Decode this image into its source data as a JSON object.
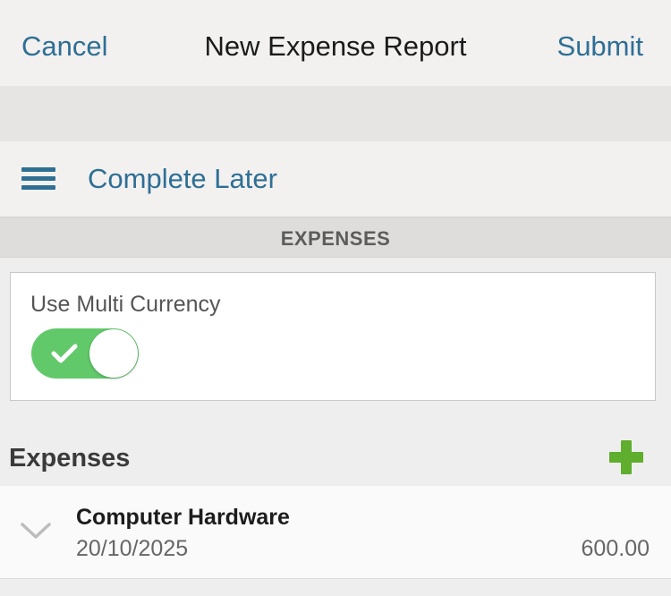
{
  "header": {
    "cancel_label": "Cancel",
    "title": "New Expense Report",
    "submit_label": "Submit"
  },
  "toolbar": {
    "menu_icon": "hamburger-menu-icon",
    "complete_later_label": "Complete Later"
  },
  "section": {
    "title": "EXPENSES"
  },
  "multi_currency": {
    "label": "Use Multi Currency",
    "enabled": true,
    "toggle_color": "#62c96b"
  },
  "expenses": {
    "title": "Expenses",
    "add_icon": "plus-icon",
    "add_icon_color": "#5fae2e",
    "items": [
      {
        "name": "Computer Hardware",
        "date": "20/10/2025",
        "amount": "600.00"
      }
    ]
  },
  "colors": {
    "link": "#2f6f94"
  }
}
